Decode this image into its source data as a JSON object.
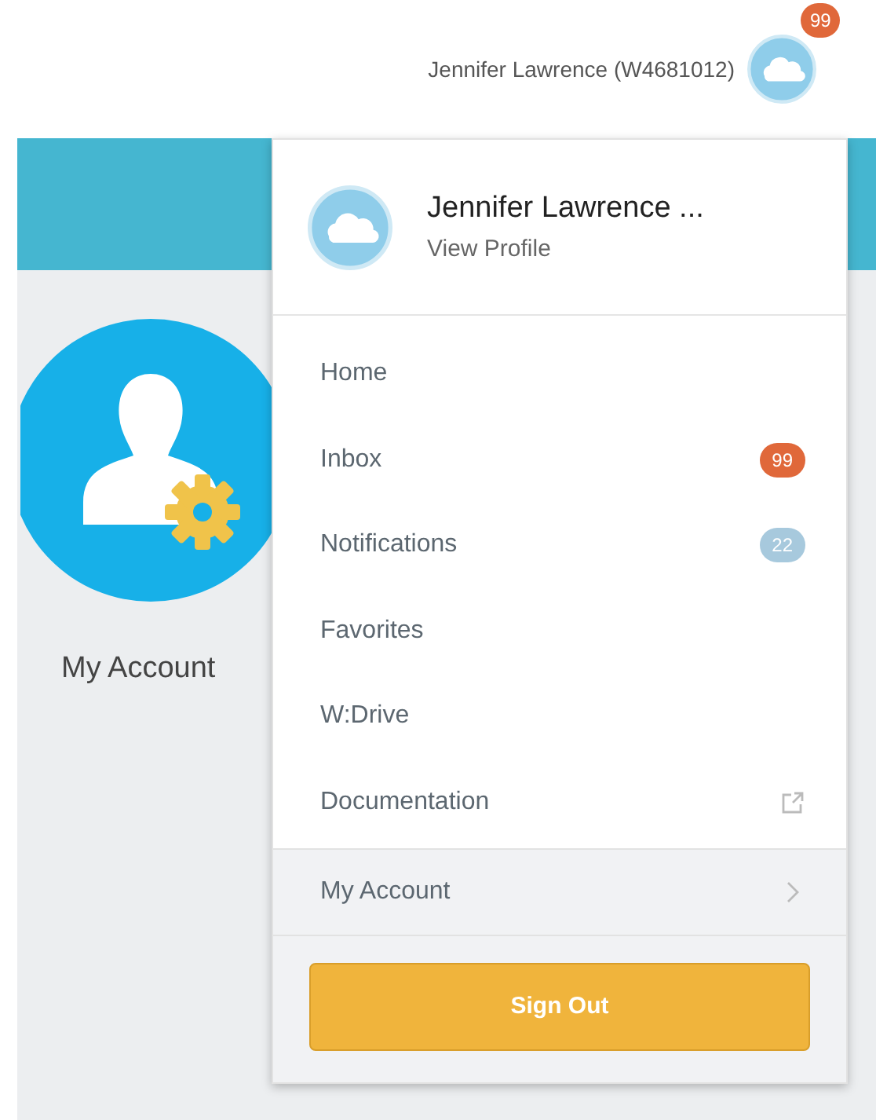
{
  "header": {
    "user_label": "Jennifer Lawrence (W4681012)",
    "avatar_badge": "99"
  },
  "page": {
    "tile_label": "My Account"
  },
  "menu": {
    "name": "Jennifer Lawrence ...",
    "profile_link": "View Profile",
    "items": [
      {
        "label": "Home",
        "kind": "plain"
      },
      {
        "label": "Inbox",
        "kind": "badge",
        "count": "99",
        "color": "#e0683a"
      },
      {
        "label": "Notifications",
        "kind": "badge",
        "count": "22",
        "color": "#a7c9dd"
      },
      {
        "label": "Favorites",
        "kind": "plain"
      },
      {
        "label": "W:Drive",
        "kind": "plain"
      },
      {
        "label": "Documentation",
        "kind": "external"
      }
    ],
    "account_row": "My Account",
    "sign_out": "Sign Out"
  }
}
